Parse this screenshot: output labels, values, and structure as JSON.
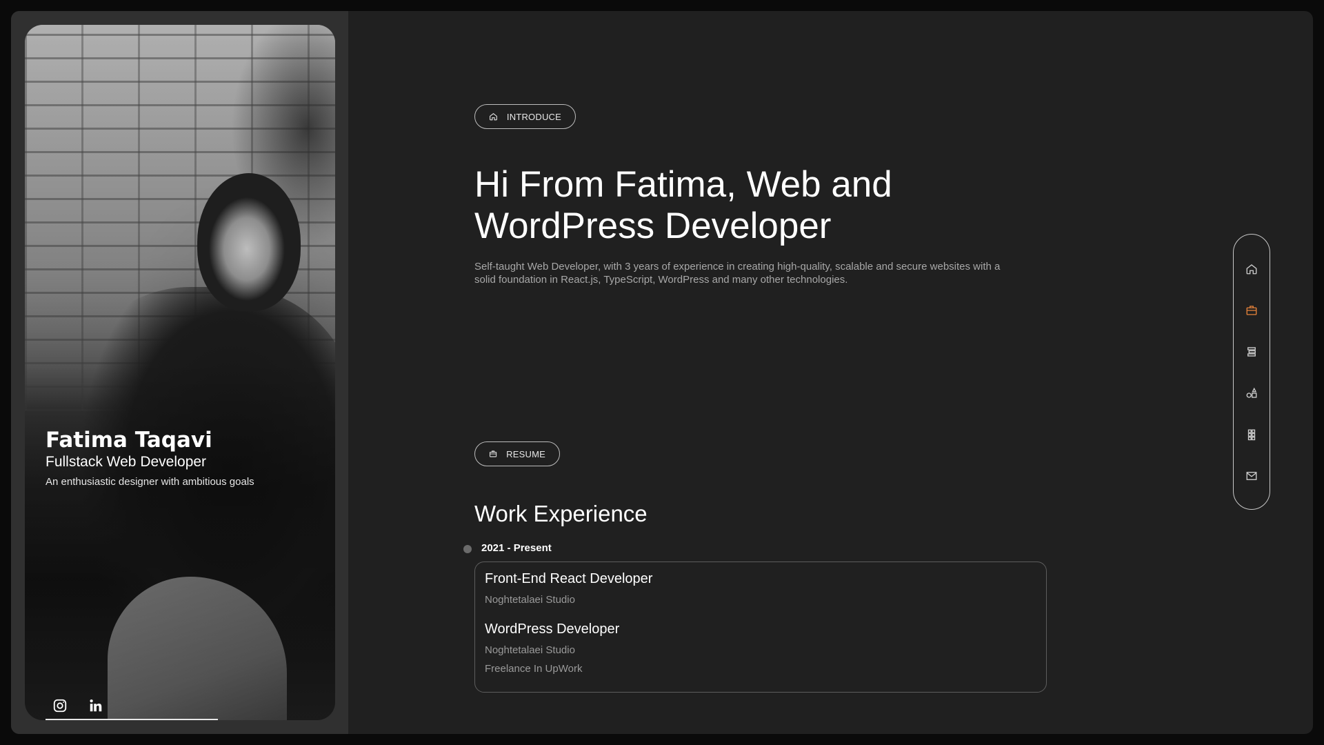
{
  "profile": {
    "name": "Fatima Taqavi",
    "role": "Fullstack Web Developer",
    "tagline": "An enthusiastic designer with ambitious goals",
    "socials": [
      {
        "icon": "instagram-icon"
      },
      {
        "icon": "linkedin-icon"
      }
    ]
  },
  "intro": {
    "badge_label": "INTRODUCE",
    "badge_icon": "home-icon",
    "title_line1": "Hi From Fatima, Web and",
    "title_line2": "WordPress Developer",
    "description_line1": "Self-taught Web Developer, with 3 years of experience in creating high-quality, scalable and secure websites with a",
    "description_line2": "solid foundation in React.js, TypeScript, WordPress and many other technologies."
  },
  "resume": {
    "badge_label": "RESUME",
    "badge_icon": "briefcase-icon",
    "section_title": "Work Experience",
    "period": "2021 - Present",
    "jobs": [
      {
        "title": "Front-End React Developer",
        "company": "Noghtetalaei Studio"
      },
      {
        "title": "WordPress Developer",
        "company": "Noghtetalaei Studio",
        "extra": "Freelance In UpWork"
      }
    ]
  },
  "nav": {
    "items": [
      {
        "icon": "home-icon",
        "active": false
      },
      {
        "icon": "briefcase-icon",
        "active": true
      },
      {
        "icon": "list-icon",
        "active": false
      },
      {
        "icon": "shapes-icon",
        "active": false
      },
      {
        "icon": "grid-icon",
        "active": false
      },
      {
        "icon": "mail-icon",
        "active": false
      }
    ],
    "active_color": "#e8833a",
    "inactive_color": "#cfcfcf"
  },
  "colors": {
    "background": "#202020",
    "left_panel": "#303030",
    "accent": "#e8833a"
  }
}
